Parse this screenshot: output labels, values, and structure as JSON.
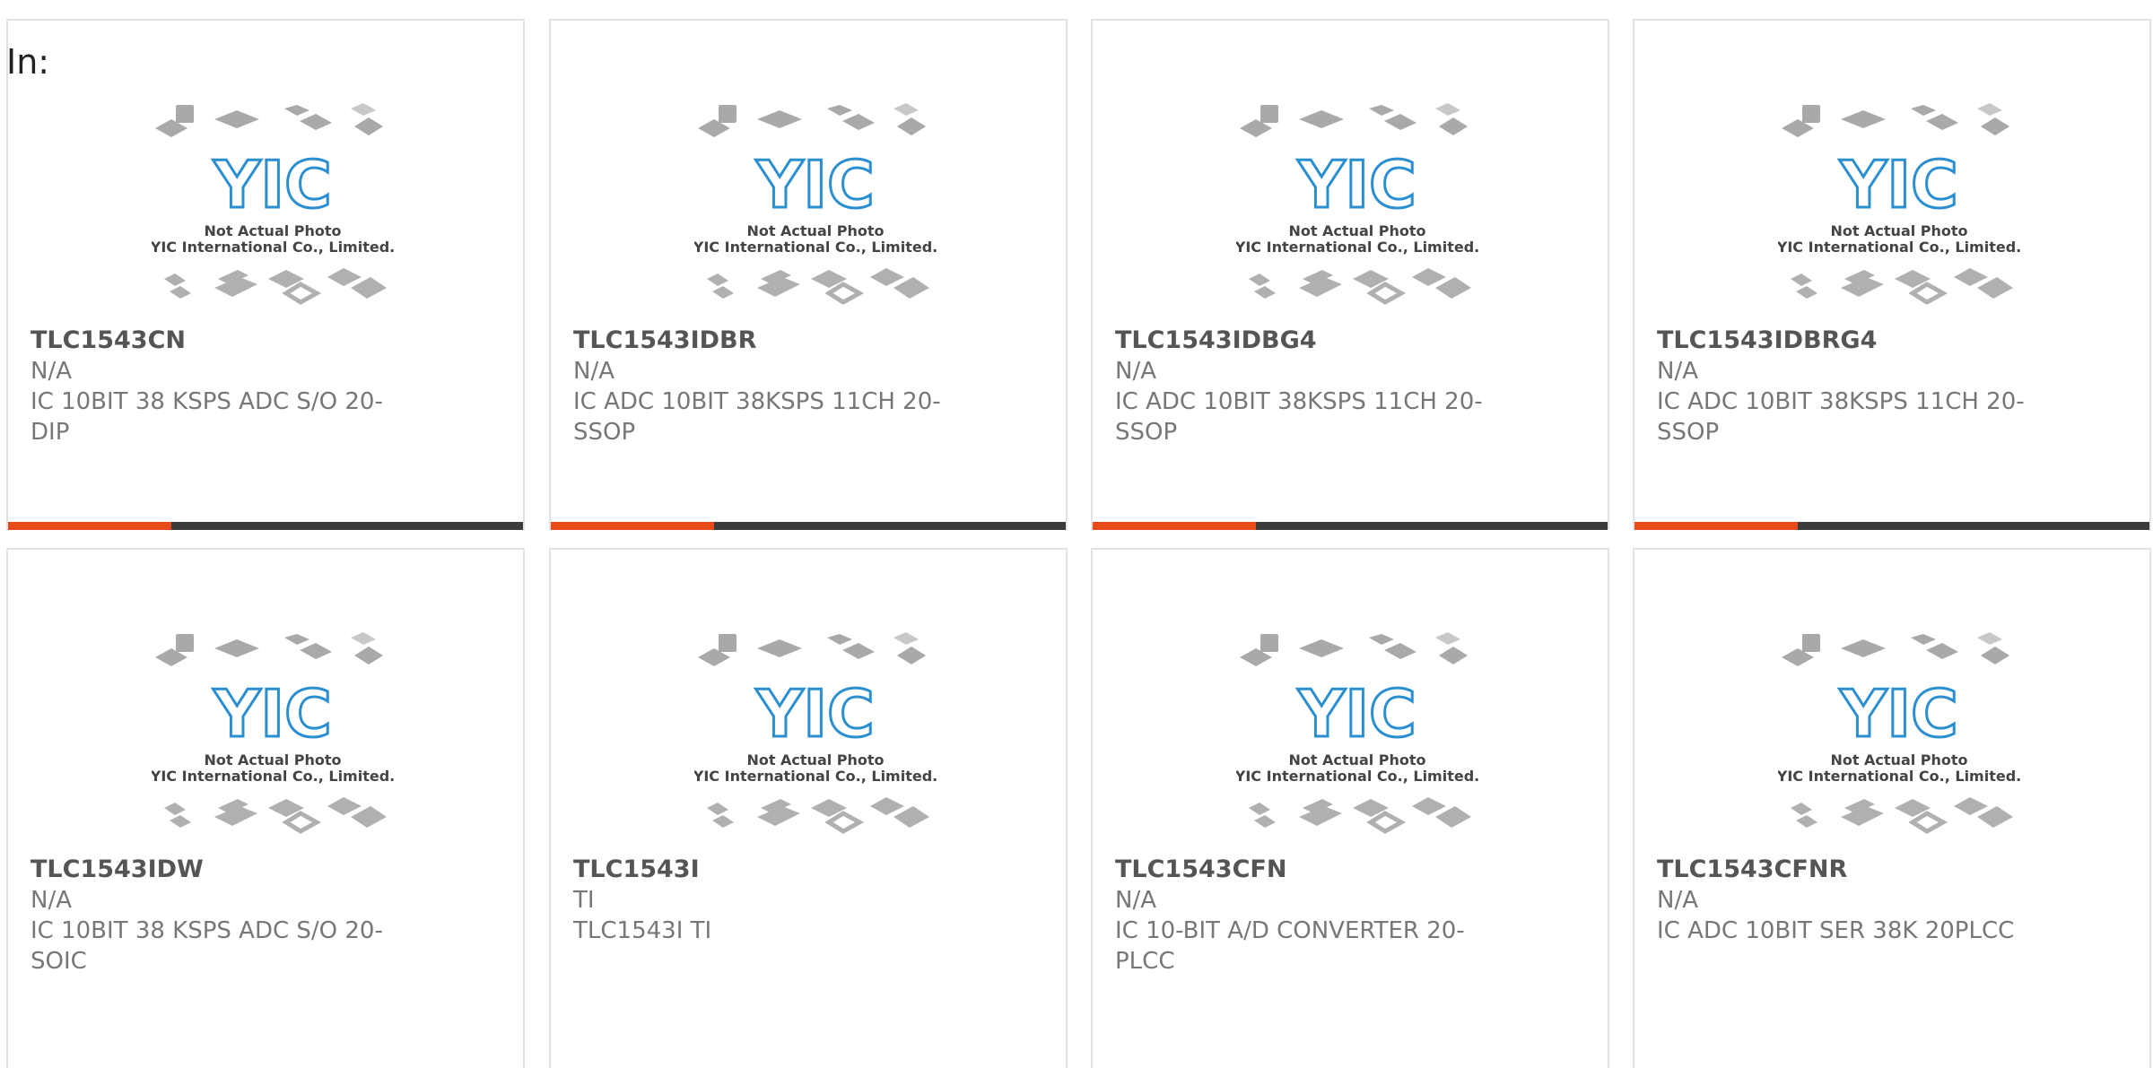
{
  "header": {
    "in_label": "In:"
  },
  "placeholder_image": {
    "line1": "Not Actual Photo",
    "line2": "YIC International Co., Limited.",
    "logo_text": "YIC"
  },
  "colors": {
    "accent": "#e84a1a",
    "bar": "#3c3c3c",
    "logo_blue": "#2a8fd0",
    "chip_gray": "#a9a9a9"
  },
  "products": [
    {
      "part": "TLC1543CN",
      "mfr": "N/A",
      "desc": "IC 10BIT 38 KSPS ADC S/O 20-DIP"
    },
    {
      "part": "TLC1543IDBR",
      "mfr": "N/A",
      "desc": "IC ADC 10BIT 38KSPS 11CH 20-SSOP"
    },
    {
      "part": "TLC1543IDBG4",
      "mfr": "N/A",
      "desc": "IC ADC 10BIT 38KSPS 11CH 20-SSOP"
    },
    {
      "part": "TLC1543IDBRG4",
      "mfr": "N/A",
      "desc": "IC ADC 10BIT 38KSPS 11CH 20-SSOP"
    },
    {
      "part": "TLC1543IDW",
      "mfr": "N/A",
      "desc": "IC 10BIT 38 KSPS ADC S/O 20-SOIC"
    },
    {
      "part": "TLC1543I",
      "mfr": "TI",
      "desc": "TLC1543I TI"
    },
    {
      "part": "TLC1543CFN",
      "mfr": "N/A",
      "desc": "IC 10-BIT A/D CONVERTER 20-PLCC"
    },
    {
      "part": "TLC1543CFNR",
      "mfr": "N/A",
      "desc": "IC ADC 10BIT SER 38K 20PLCC"
    }
  ]
}
